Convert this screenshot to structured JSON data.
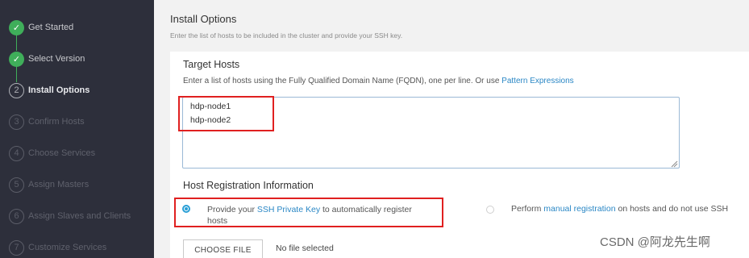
{
  "sidebar": {
    "steps": [
      {
        "label": "Get Started",
        "state": "done",
        "icon": "check-icon"
      },
      {
        "label": "Select Version",
        "state": "done",
        "icon": "check-icon"
      },
      {
        "label": "Install Options",
        "state": "active",
        "number": "2"
      },
      {
        "label": "Confirm Hosts",
        "state": "todo",
        "number": "3"
      },
      {
        "label": "Choose Services",
        "state": "todo",
        "number": "4"
      },
      {
        "label": "Assign Masters",
        "state": "todo",
        "number": "5"
      },
      {
        "label": "Assign Slaves and Clients",
        "state": "todo",
        "number": "6"
      },
      {
        "label": "Customize Services",
        "state": "todo",
        "number": "7"
      }
    ]
  },
  "header": {
    "title": "Install Options",
    "subtitle": "Enter the list of hosts to be included in the cluster and provide your SSH key."
  },
  "target_hosts": {
    "title": "Target Hosts",
    "description": "Enter a list of hosts using the Fully Qualified Domain Name (FQDN), one per line. Or use ",
    "link": "Pattern Expressions",
    "hosts": [
      "hdp-node1",
      "hdp-node2"
    ]
  },
  "registration": {
    "title": "Host Registration Information",
    "option1": {
      "prefix": "Provide your ",
      "link": "SSH Private Key",
      "suffix": " to automatically register",
      "line2": "hosts",
      "selected": true
    },
    "option2": {
      "prefix": "Perform ",
      "link": "manual registration",
      "suffix": " on hosts and do not use SSH",
      "selected": false
    }
  },
  "file": {
    "button": "CHOOSE FILE",
    "status": "No file selected"
  },
  "watermark": "CSDN @阿龙先生啊",
  "colors": {
    "sidebar_bg": "#2d2f3b",
    "done_green": "#3fae5a",
    "link_blue": "#2a87c5",
    "highlight_red": "#e02020"
  }
}
